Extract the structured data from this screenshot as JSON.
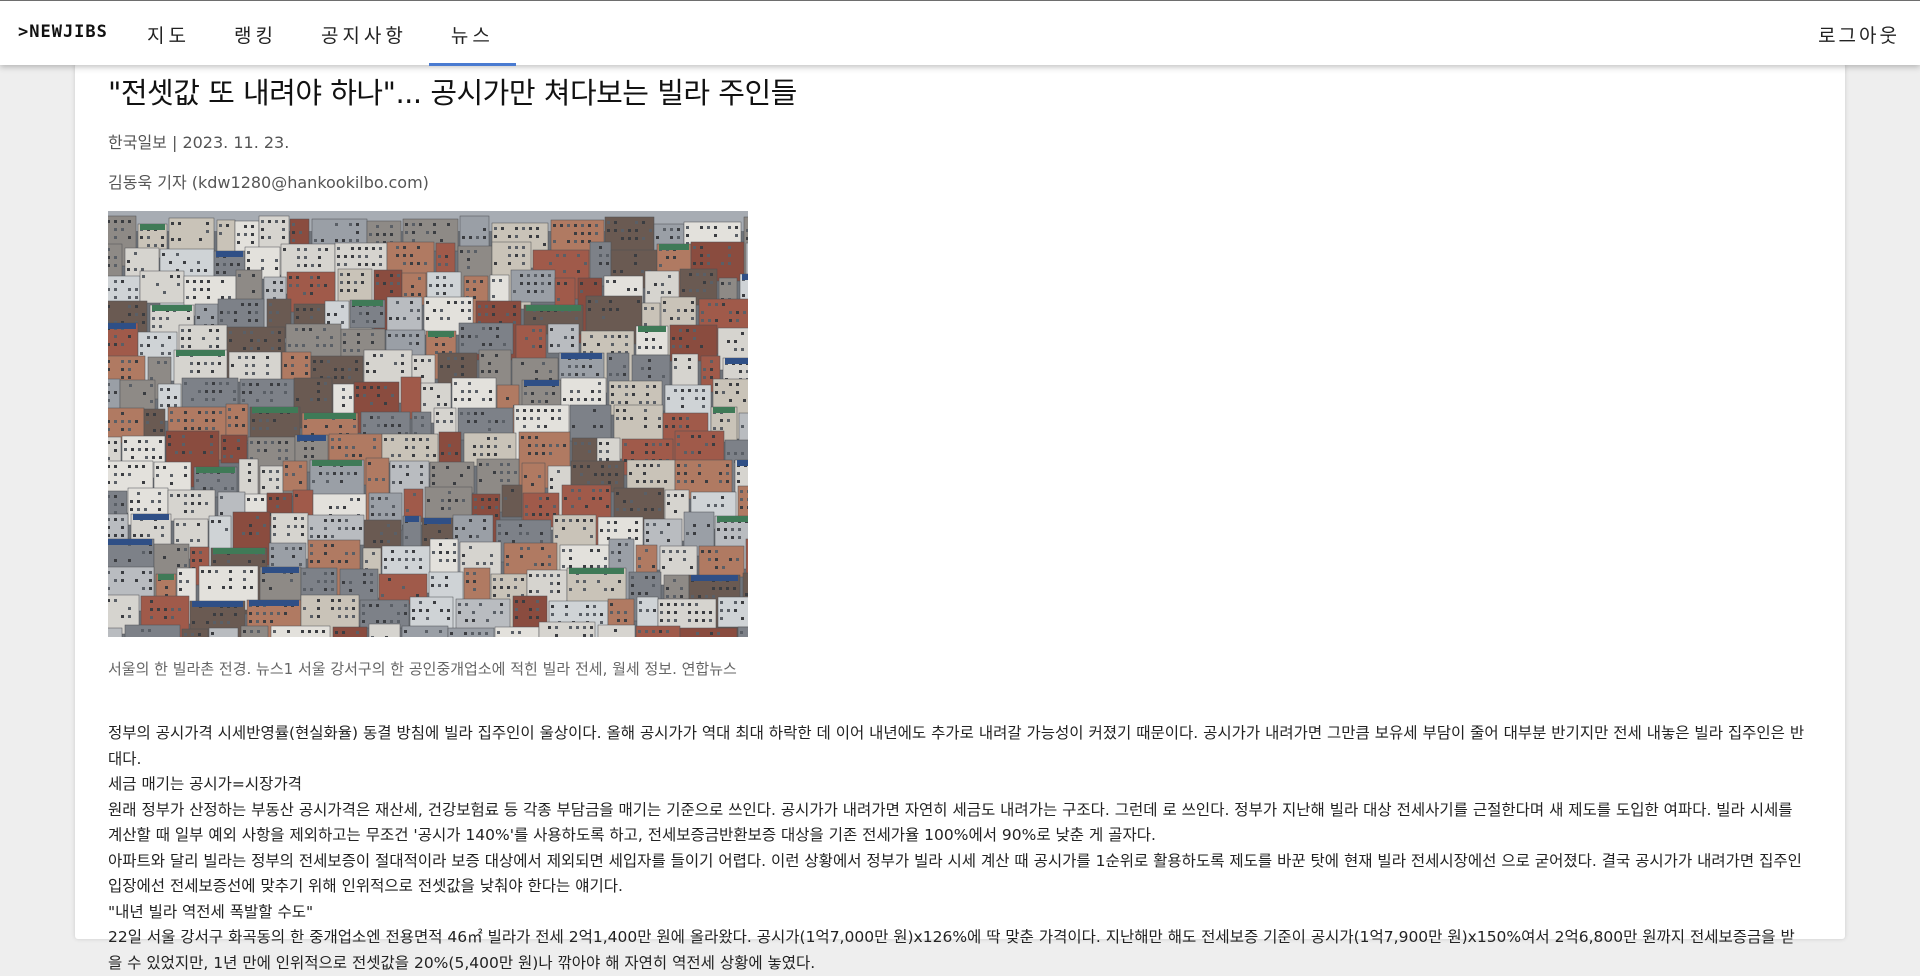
{
  "header": {
    "brand": ">NEWJIBS",
    "nav": [
      {
        "label": "지도",
        "active": false
      },
      {
        "label": "랭킹",
        "active": false
      },
      {
        "label": "공지사항",
        "active": false
      },
      {
        "label": "뉴스",
        "active": true
      }
    ],
    "logout_label": "로그아웃",
    "accent_color": "#4a7bd1"
  },
  "article": {
    "title": "\"전셋값 또 내려야 하나\"... 공시가만 쳐다보는 빌라 주인들",
    "meta": "한국일보 | 2023. 11. 23.",
    "author": "김동욱 기자 (kdw1280@hankookilbo.com)",
    "image_alt": "서울 빌라촌 전경 사진",
    "caption": "서울의 한 빌라촌 전경. 뉴스1 서울 강서구의 한 공인중개업소에 적힌 빌라 전세, 월세 정보. 연합뉴스",
    "paragraphs": [
      "정부의 공시가격 시세반영률(현실화율) 동결 방침에 빌라 집주인이 울상이다. 올해 공시가가 역대 최대 하락한 데 이어 내년에도 추가로 내려갈 가능성이 커졌기 때문이다. 공시가가 내려가면 그만큼 보유세 부담이 줄어 대부분 반기지만 전세 내놓은 빌라 집주인은 반대다.",
      "세금 매기는 공시가=시장가격",
      "원래 정부가 산정하는 부동산 공시가격은 재산세, 건강보험료 등 각종 부담금을 매기는 기준으로 쓰인다. 공시가가 내려가면 자연히 세금도 내려가는 구조다. 그런데 로 쓰인다. 정부가 지난해 빌라 대상 전세사기를 근절한다며 새 제도를 도입한 여파다. 빌라 시세를 계산할 때 일부 예외 사항을 제외하고는 무조건 '공시가 140%'를 사용하도록 하고, 전세보증금반환보증 대상을 기존 전세가율 100%에서 90%로 낮춘 게 골자다.",
      "아파트와 달리 빌라는 정부의 전세보증이 절대적이라 보증 대상에서 제외되면 세입자를 들이기 어렵다. 이런 상황에서 정부가 빌라 시세 계산 때 공시가를 1순위로 활용하도록 제도를 바꾼 탓에 현재 빌라 전세시장에선 으로 굳어졌다. 결국 공시가가 내려가면 집주인 입장에선 전세보증선에 맞추기 위해 인위적으로 전셋값을 낮춰야 한다는 얘기다.",
      "\"내년 빌라 역전세 폭발할 수도\"",
      "22일 서울 강서구 화곡동의 한 중개업소엔 전용면적 46㎡ 빌라가 전세 2억1,400만 원에 올라왔다. 공시가(1억7,000만 원)x126%에 딱 맞춘 가격이다. 지난해만 해도 전세보증 기준이 공시가(1억7,900만 원)x150%여서 2억6,800만 원까지 전세보증금을 받을 수 있었지만, 1년 만에 인위적으로 전셋값을 20%(5,400만 원)나 깎아야 해 자연히 역전세 상황에 놓였다."
    ]
  }
}
